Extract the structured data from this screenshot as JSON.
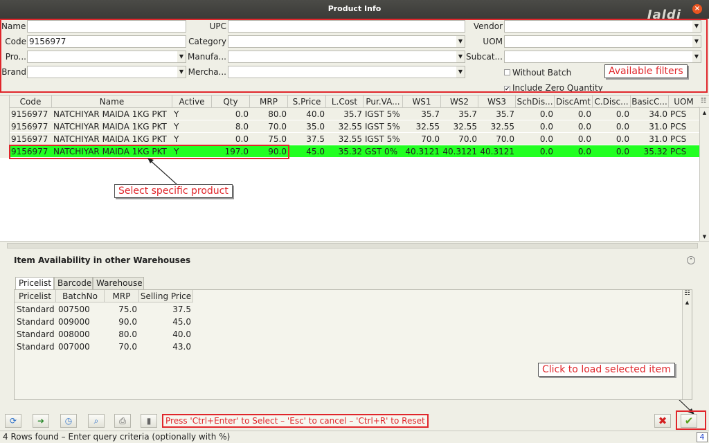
{
  "window": {
    "title": "Product Info",
    "watermark": "Jaldi",
    "close_glyph": "×"
  },
  "filters": {
    "name_label": "Name",
    "name_value": "",
    "code_label": "Code",
    "code_value": "9156977",
    "product_label": "Pro...",
    "brand_label": "Brand",
    "upc_label": "UPC",
    "category_label": "Category",
    "manufacturer_label": "Manufa...",
    "merchandise_label": "Mercha...",
    "vendor_label": "Vendor",
    "uom_label": "UOM",
    "subcategory_label": "Subcat...",
    "without_batch_label": "Without Batch",
    "without_batch_checked": false,
    "include_zero_label": "Include Zero Quantity",
    "include_zero_checked": true
  },
  "annotations": {
    "filters_callout": "Available filters",
    "select_callout": "Select specific product",
    "load_callout": "Click to load selected item"
  },
  "grid": {
    "columns": [
      "Code",
      "Name",
      "Active",
      "Qty",
      "MRP",
      "S.Price",
      "L.Cost",
      "Pur.VA...",
      "WS1",
      "WS2",
      "WS3",
      "SchDis...",
      "DiscAmt",
      "C.Disc...",
      "BasicC...",
      "UOM"
    ],
    "rows": [
      [
        "9156977",
        "NATCHIYAR MAIDA 1KG PKT",
        "Y",
        "0.0",
        "80.0",
        "40.0",
        "35.7",
        "IGST 5%",
        "35.7",
        "35.7",
        "35.7",
        "0.0",
        "0.0",
        "0.0",
        "34.0",
        "PCS"
      ],
      [
        "9156977",
        "NATCHIYAR MAIDA 1KG PKT",
        "Y",
        "8.0",
        "70.0",
        "35.0",
        "32.55",
        "IGST 5%",
        "32.55",
        "32.55",
        "32.55",
        "0.0",
        "0.0",
        "0.0",
        "31.0",
        "PCS"
      ],
      [
        "9156977",
        "NATCHIYAR MAIDA 1KG PKT",
        "Y",
        "0.0",
        "75.0",
        "37.5",
        "32.55",
        "IGST 5%",
        "70.0",
        "70.0",
        "70.0",
        "0.0",
        "0.0",
        "0.0",
        "31.0",
        "PCS"
      ],
      [
        "9156977",
        "NATCHIYAR MAIDA 1KG PKT",
        "Y",
        "197.0",
        "90.0",
        "45.0",
        "35.32",
        "GST 0%",
        "40.3121",
        "40.3121",
        "40.3121",
        "0.0",
        "0.0",
        "0.0",
        "35.32",
        "PCS"
      ]
    ],
    "selected_row": 3,
    "selected_color": "#22ff22"
  },
  "availability": {
    "title": "Item Availability in other Warehouses",
    "tabs": [
      "Pricelist",
      "Barcode",
      "Warehouse"
    ],
    "active_tab": "Pricelist",
    "columns": [
      "Pricelist",
      "BatchNo",
      "MRP",
      "Selling Price"
    ],
    "rows": [
      [
        "Standard",
        "007500",
        "75.0",
        "37.5"
      ],
      [
        "Standard",
        "009000",
        "90.0",
        "45.0"
      ],
      [
        "Standard",
        "008000",
        "80.0",
        "40.0"
      ],
      [
        "Standard",
        "007000",
        "70.0",
        "43.0"
      ]
    ]
  },
  "toolbar": {
    "hint": "Press 'Ctrl+Enter' to Select – 'Esc' to cancel – 'Ctrl+R' to Reset",
    "refresh_icon": "refresh-icon",
    "reset_icon": "reset-icon",
    "history_icon": "history-icon",
    "zoom_icon": "zoom-icon",
    "print_icon": "print-icon",
    "attachment_icon": "attachment-icon",
    "cancel_icon": "cancel-icon",
    "ok_icon": "ok-icon"
  },
  "status": {
    "text": "4 Rows found – Enter query criteria (optionally with %)",
    "count": "4"
  }
}
